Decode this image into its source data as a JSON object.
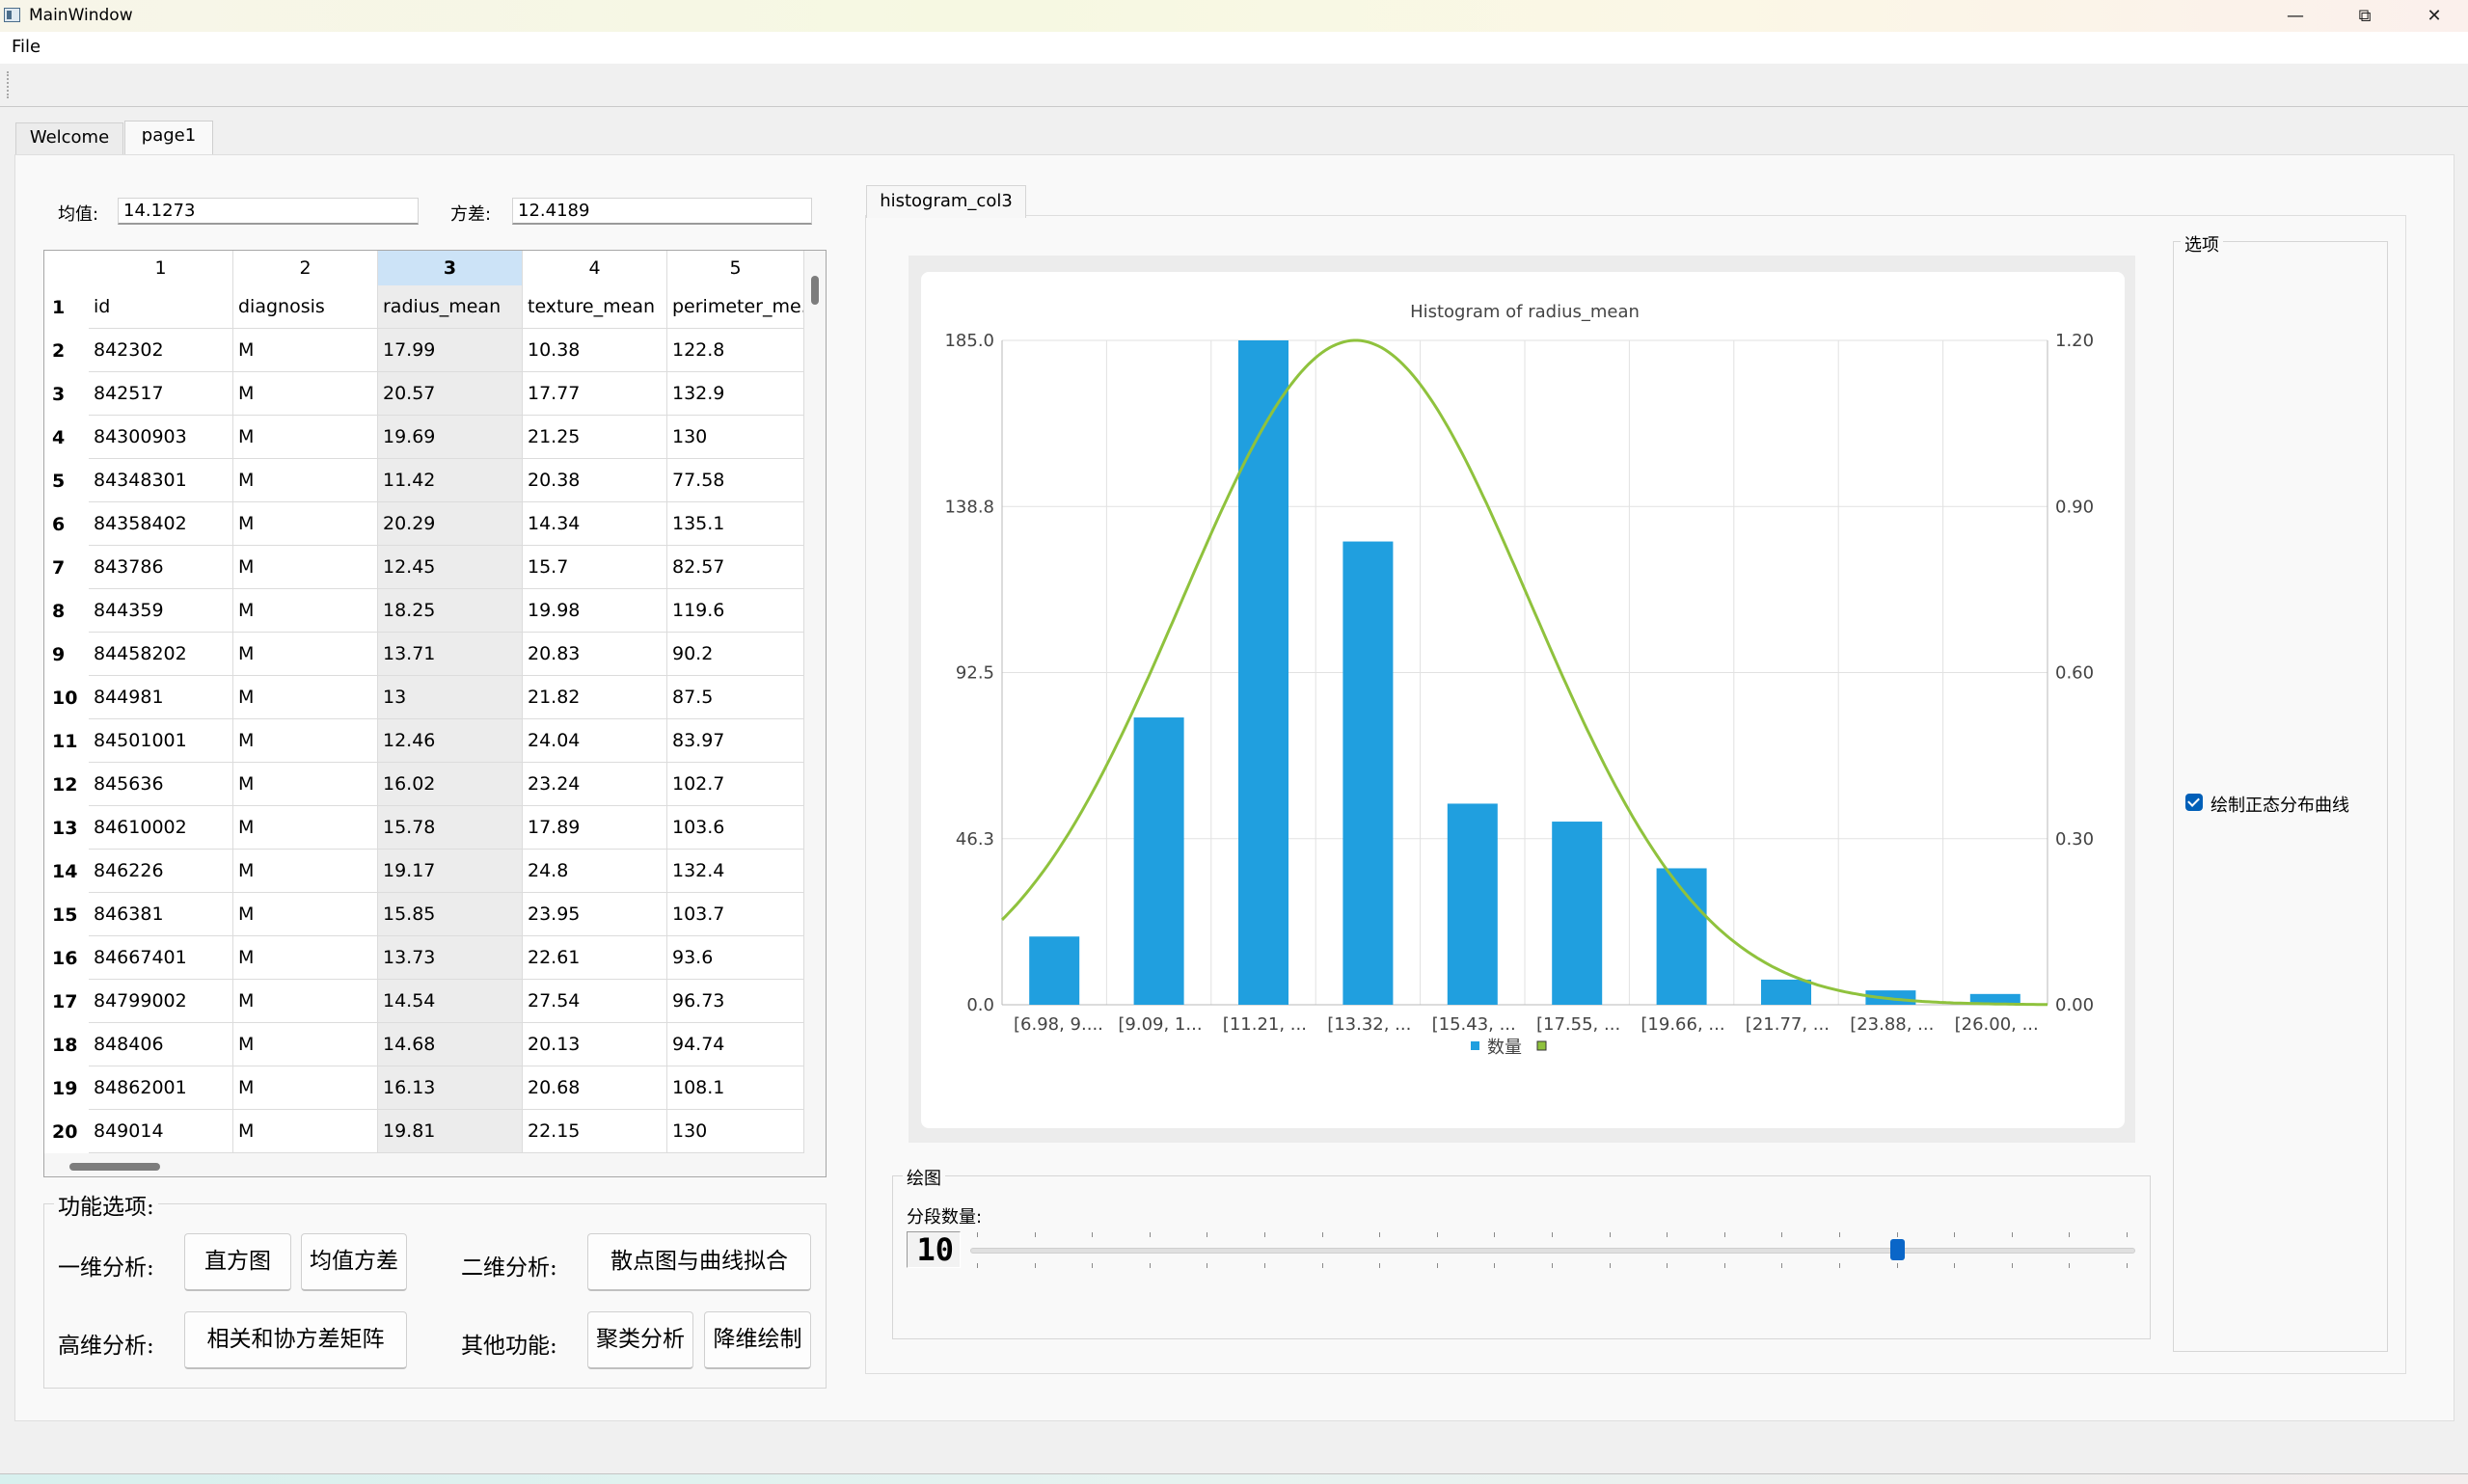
{
  "window": {
    "title": "MainWindow",
    "minimize": "—",
    "maximize": "⧉",
    "close": "✕",
    "icon": "app-window-icon"
  },
  "menu": {
    "file": "File"
  },
  "tabs": {
    "welcome": "Welcome",
    "page1": "page1"
  },
  "stats": {
    "mean_label": "均值:",
    "mean_value": "14.1273",
    "variance_label": "方差:",
    "variance_value": "12.4189"
  },
  "table": {
    "col_numbers": [
      "1",
      "2",
      "3",
      "4",
      "5"
    ],
    "selected_col_index": 2,
    "header_row_number": "1",
    "headers": [
      "id",
      "diagnosis",
      "radius_mean",
      "texture_mean",
      "perimeter_me..."
    ],
    "rows": [
      {
        "n": "2",
        "cells": [
          "842302",
          "M",
          "17.99",
          "10.38",
          "122.8"
        ]
      },
      {
        "n": "3",
        "cells": [
          "842517",
          "M",
          "20.57",
          "17.77",
          "132.9"
        ]
      },
      {
        "n": "4",
        "cells": [
          "84300903",
          "M",
          "19.69",
          "21.25",
          "130"
        ]
      },
      {
        "n": "5",
        "cells": [
          "84348301",
          "M",
          "11.42",
          "20.38",
          "77.58"
        ]
      },
      {
        "n": "6",
        "cells": [
          "84358402",
          "M",
          "20.29",
          "14.34",
          "135.1"
        ]
      },
      {
        "n": "7",
        "cells": [
          "843786",
          "M",
          "12.45",
          "15.7",
          "82.57"
        ]
      },
      {
        "n": "8",
        "cells": [
          "844359",
          "M",
          "18.25",
          "19.98",
          "119.6"
        ]
      },
      {
        "n": "9",
        "cells": [
          "84458202",
          "M",
          "13.71",
          "20.83",
          "90.2"
        ]
      },
      {
        "n": "10",
        "cells": [
          "844981",
          "M",
          "13",
          "21.82",
          "87.5"
        ]
      },
      {
        "n": "11",
        "cells": [
          "84501001",
          "M",
          "12.46",
          "24.04",
          "83.97"
        ]
      },
      {
        "n": "12",
        "cells": [
          "845636",
          "M",
          "16.02",
          "23.24",
          "102.7"
        ]
      },
      {
        "n": "13",
        "cells": [
          "84610002",
          "M",
          "15.78",
          "17.89",
          "103.6"
        ]
      },
      {
        "n": "14",
        "cells": [
          "846226",
          "M",
          "19.17",
          "24.8",
          "132.4"
        ]
      },
      {
        "n": "15",
        "cells": [
          "846381",
          "M",
          "15.85",
          "23.95",
          "103.7"
        ]
      },
      {
        "n": "16",
        "cells": [
          "84667401",
          "M",
          "13.73",
          "22.61",
          "93.6"
        ]
      },
      {
        "n": "17",
        "cells": [
          "84799002",
          "M",
          "14.54",
          "27.54",
          "96.73"
        ]
      },
      {
        "n": "18",
        "cells": [
          "848406",
          "M",
          "14.68",
          "20.13",
          "94.74"
        ]
      },
      {
        "n": "19",
        "cells": [
          "84862001",
          "M",
          "16.13",
          "20.68",
          "108.1"
        ]
      },
      {
        "n": "20",
        "cells": [
          "849014",
          "M",
          "19.81",
          "22.15",
          "130"
        ]
      }
    ]
  },
  "functions": {
    "title": "功能选项:",
    "one_dim_label": "一维分析:",
    "histogram_btn": "直方图",
    "mean_var_btn": "均值方差",
    "two_dim_label": "二维分析:",
    "scatter_btn": "散点图与曲线拟合",
    "high_dim_label": "高维分析:",
    "corr_btn": "相关和协方差矩阵",
    "other_label": "其他功能:",
    "cluster_btn": "聚类分析",
    "dimred_btn": "降维绘制"
  },
  "chart_tab": "histogram_col3",
  "options": {
    "title": "选项",
    "normal_curve_label": "绘制正态分布曲线",
    "normal_curve_checked": true
  },
  "draw": {
    "title": "绘图",
    "bins_label": "分段数量:",
    "bins_value": "10",
    "slider_min": 0,
    "slider_max": 20,
    "slider_value": 16
  },
  "colors": {
    "bar": "#209fdf",
    "curve": "#8fc23d",
    "selected_header": "#cce3f7",
    "slider_handle": "#0a66c8"
  },
  "chart_data": {
    "type": "bar",
    "title": "Histogram of radius_mean",
    "categories": [
      "[6.98, 9....",
      "[9.09, 1...",
      "[11.21, ...",
      "[13.32, ...",
      "[15.43, ...",
      "[17.55, ...",
      "[19.66, ...",
      "[21.77, ...",
      "[23.88, ...",
      "[26.00, ..."
    ],
    "series": [
      {
        "name": "数量",
        "values": [
          19,
          80,
          185,
          129,
          56,
          51,
          38,
          7,
          4,
          3
        ]
      }
    ],
    "curve": {
      "type": "line",
      "axis": "right",
      "mean": 14.1273,
      "variance": 12.4189,
      "peak": 1.2,
      "x_min": 6.98,
      "x_max": 28.11
    },
    "y_left_ticks": [
      "185.0",
      "138.8",
      "92.5",
      "46.3",
      "0.0"
    ],
    "y_right_ticks": [
      "1.20",
      "0.90",
      "0.60",
      "0.30",
      "0.00"
    ],
    "ylim_left": [
      0,
      185
    ],
    "ylim_right": [
      0,
      1.2
    ],
    "grid": true,
    "legend_position": "bottom"
  }
}
